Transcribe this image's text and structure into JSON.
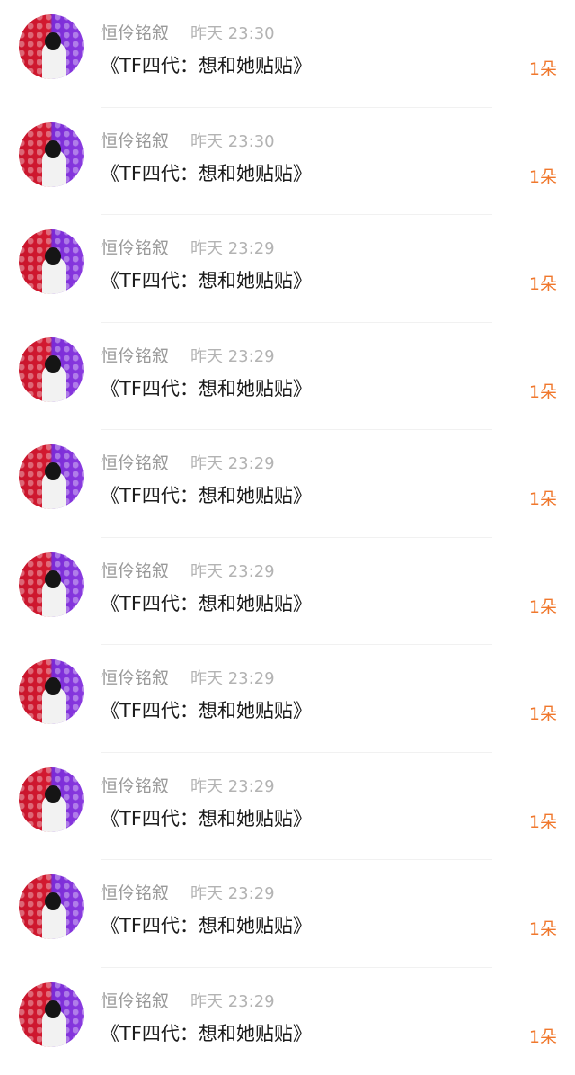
{
  "list": {
    "items": [
      {
        "name": "恒伶铭叙",
        "time": "昨天 23:30",
        "gift": "《TF四代：想和她贴贴》",
        "count": "1朵"
      },
      {
        "name": "恒伶铭叙",
        "time": "昨天 23:30",
        "gift": "《TF四代：想和她贴贴》",
        "count": "1朵"
      },
      {
        "name": "恒伶铭叙",
        "time": "昨天 23:29",
        "gift": "《TF四代：想和她贴贴》",
        "count": "1朵"
      },
      {
        "name": "恒伶铭叙",
        "time": "昨天 23:29",
        "gift": "《TF四代：想和她贴贴》",
        "count": "1朵"
      },
      {
        "name": "恒伶铭叙",
        "time": "昨天 23:29",
        "gift": "《TF四代：想和她贴贴》",
        "count": "1朵"
      },
      {
        "name": "恒伶铭叙",
        "time": "昨天 23:29",
        "gift": "《TF四代：想和她贴贴》",
        "count": "1朵"
      },
      {
        "name": "恒伶铭叙",
        "time": "昨天 23:29",
        "gift": "《TF四代：想和她贴贴》",
        "count": "1朵"
      },
      {
        "name": "恒伶铭叙",
        "time": "昨天 23:29",
        "gift": "《TF四代：想和她贴贴》",
        "count": "1朵"
      },
      {
        "name": "恒伶铭叙",
        "time": "昨天 23:29",
        "gift": "《TF四代：想和她贴贴》",
        "count": "1朵"
      },
      {
        "name": "恒伶铭叙",
        "time": "昨天 23:29",
        "gift": "《TF四代：想和她贴贴》",
        "count": "1朵"
      }
    ]
  },
  "colors": {
    "count_accent": "#f0782d",
    "name_gray": "#9a9a9a",
    "time_gray": "#b3b3b3"
  }
}
